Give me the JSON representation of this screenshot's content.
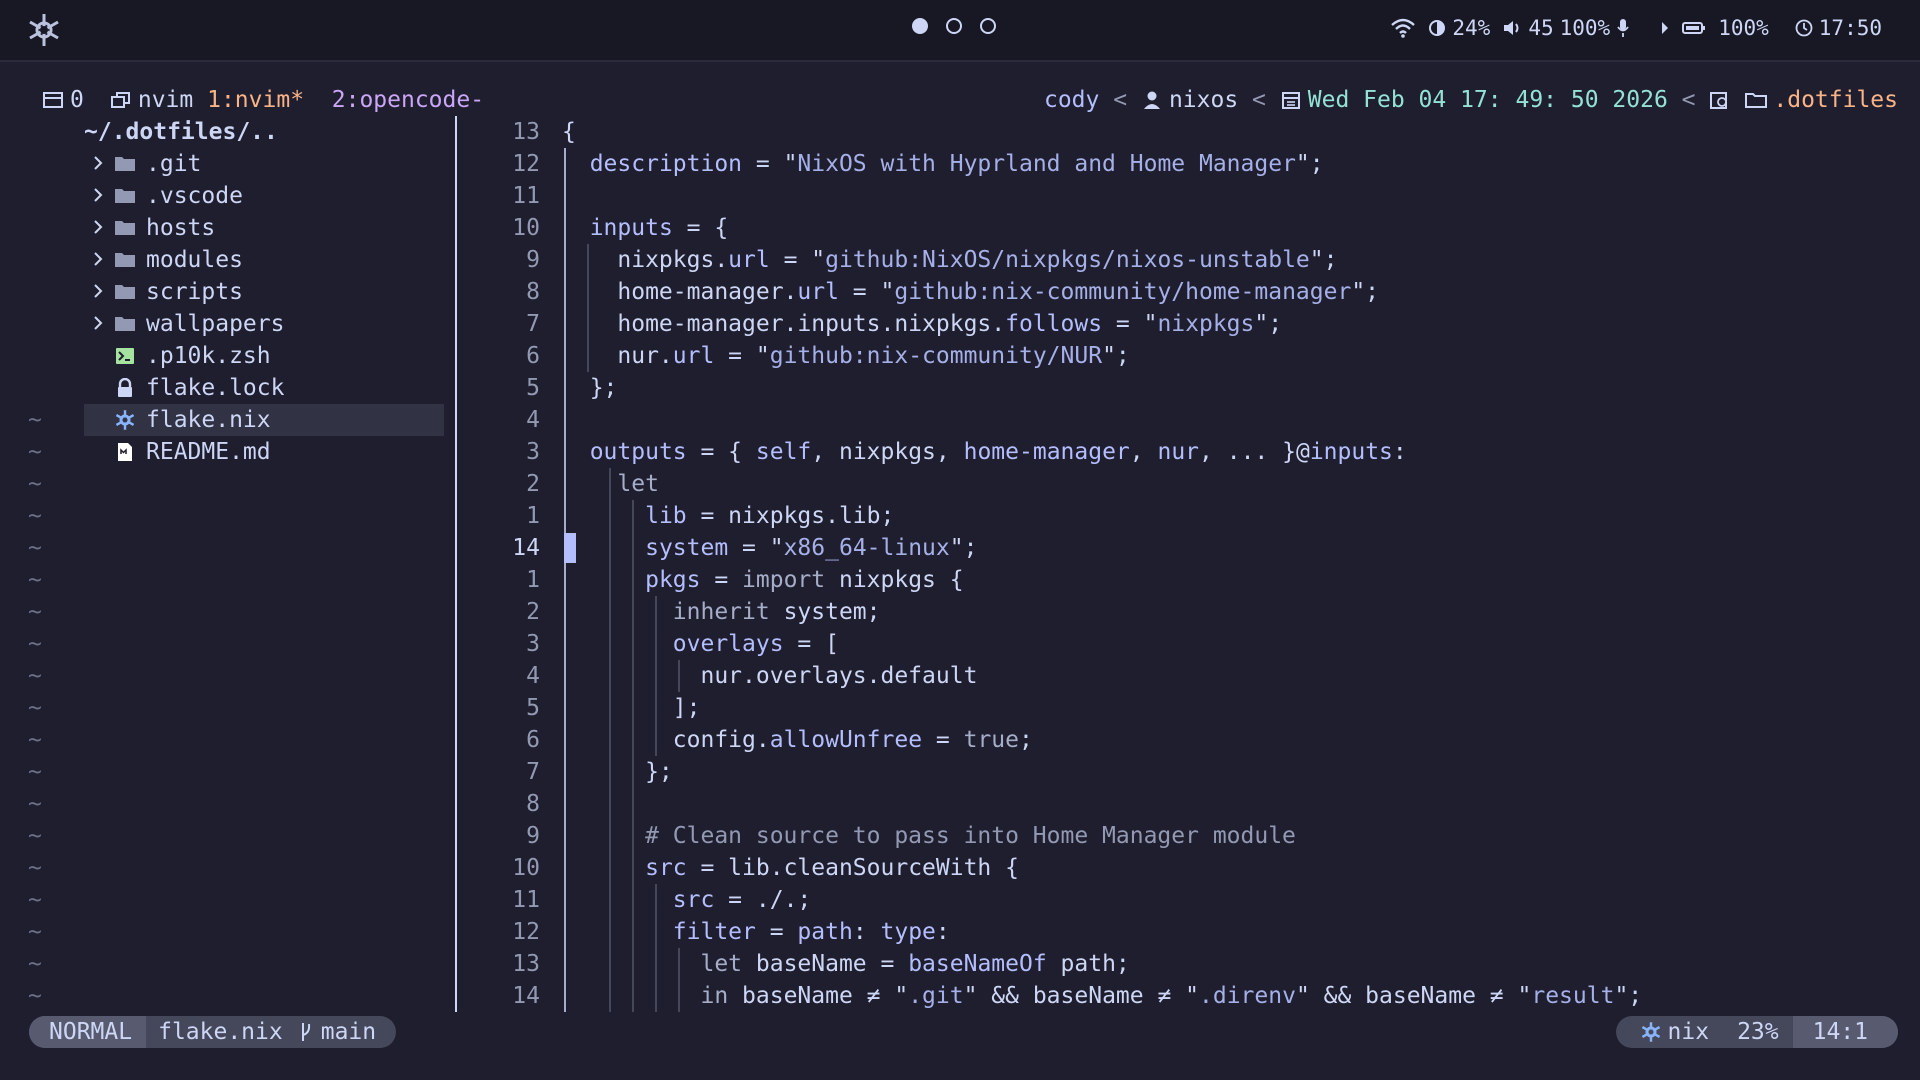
{
  "topbar": {
    "logo_icon": "nix-snowflake-icon",
    "workspaces": [
      {
        "name": "workspace-1",
        "active": true
      },
      {
        "name": "workspace-2",
        "active": false
      },
      {
        "name": "workspace-3",
        "active": false
      }
    ],
    "brightness": "24%",
    "volume": "45",
    "volume_level": "100%",
    "battery": "100%",
    "clock": "17:50"
  },
  "tmux": {
    "session": "0",
    "window_app": "nvim",
    "window1": "1:nvim*",
    "window2": "2:opencode-",
    "user": "cody",
    "host": "nixos",
    "datetime": "Wed Feb 04 17: 49: 50 2026",
    "sep": "<",
    "dir": ".dotfiles"
  },
  "tree": {
    "root": "~/.dotfiles/..",
    "items": [
      {
        "label": ".git",
        "type": "folder"
      },
      {
        "label": ".vscode",
        "type": "folder"
      },
      {
        "label": "hosts",
        "type": "folder"
      },
      {
        "label": "modules",
        "type": "folder"
      },
      {
        "label": "scripts",
        "type": "folder"
      },
      {
        "label": "wallpapers",
        "type": "folder"
      },
      {
        "label": ".p10k.zsh",
        "type": "shell"
      },
      {
        "label": "flake.lock",
        "type": "lock"
      },
      {
        "label": "flake.nix",
        "type": "nix",
        "selected": true
      },
      {
        "label": "README.md",
        "type": "markdown"
      }
    ],
    "tilde": "~"
  },
  "editor": {
    "lines": [
      {
        "num": "13",
        "text": "{"
      },
      {
        "num": "12",
        "text": "  description = \"NixOS with Hyprland and Home Manager\";"
      },
      {
        "num": "11",
        "text": ""
      },
      {
        "num": "10",
        "text": "  inputs = {"
      },
      {
        "num": "9",
        "text": "    nixpkgs.url = \"github:NixOS/nixpkgs/nixos-unstable\";"
      },
      {
        "num": "8",
        "text": "    home-manager.url = \"github:nix-community/home-manager\";"
      },
      {
        "num": "7",
        "text": "    home-manager.inputs.nixpkgs.follows = \"nixpkgs\";"
      },
      {
        "num": "6",
        "text": "    nur.url = \"github:nix-community/NUR\";"
      },
      {
        "num": "5",
        "text": "  };"
      },
      {
        "num": "4",
        "text": ""
      },
      {
        "num": "3",
        "text": "  outputs = { self, nixpkgs, home-manager, nur, ... }@inputs:"
      },
      {
        "num": "2",
        "text": "    let"
      },
      {
        "num": "1",
        "text": "      lib = nixpkgs.lib;"
      },
      {
        "num": "14",
        "text": "      system = \"x86_64-linux\";",
        "current": true
      },
      {
        "num": "1",
        "text": "      pkgs = import nixpkgs {"
      },
      {
        "num": "2",
        "text": "        inherit system;"
      },
      {
        "num": "3",
        "text": "        overlays = ["
      },
      {
        "num": "4",
        "text": "          nur.overlays.default"
      },
      {
        "num": "5",
        "text": "        ];"
      },
      {
        "num": "6",
        "text": "        config.allowUnfree = true;"
      },
      {
        "num": "7",
        "text": "      };"
      },
      {
        "num": "8",
        "text": ""
      },
      {
        "num": "9",
        "text": "      # Clean source to pass into Home Manager module"
      },
      {
        "num": "10",
        "text": "      src = lib.cleanSourceWith {"
      },
      {
        "num": "11",
        "text": "        src = ./.;"
      },
      {
        "num": "12",
        "text": "        filter = path: type:"
      },
      {
        "num": "13",
        "text": "          let baseName = baseNameOf path;"
      },
      {
        "num": "14",
        "text": "          in baseName ≠ \".git\" && baseName ≠ \".direnv\" && baseName ≠ \"result\";"
      }
    ]
  },
  "statusline": {
    "mode": "NORMAL",
    "filename": "flake.nix",
    "branch": "main",
    "filetype": "nix",
    "percent": "23%",
    "position": "14:1"
  },
  "colors": {
    "background": "#1e1e2e",
    "text": "#cdd6f4",
    "accent_peach": "#fab387",
    "accent_mauve": "#cba6f7",
    "accent_teal": "#94e2d5",
    "accent_lavender": "#b4befe"
  }
}
